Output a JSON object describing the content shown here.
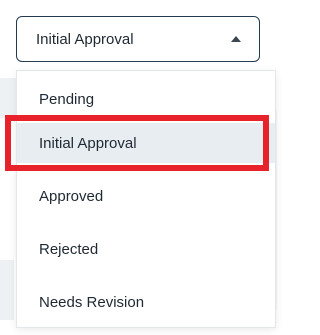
{
  "select": {
    "value": "Initial Approval",
    "caret_icon": "caret-up-icon"
  },
  "menu": {
    "items": [
      {
        "label": "Pending",
        "selected": false
      },
      {
        "label": "Initial Approval",
        "selected": true
      },
      {
        "label": "Approved",
        "selected": false
      },
      {
        "label": "Rejected",
        "selected": false
      },
      {
        "label": "Needs Revision",
        "selected": false
      }
    ]
  },
  "annotation": {
    "highlight_color": "#e8222b"
  }
}
